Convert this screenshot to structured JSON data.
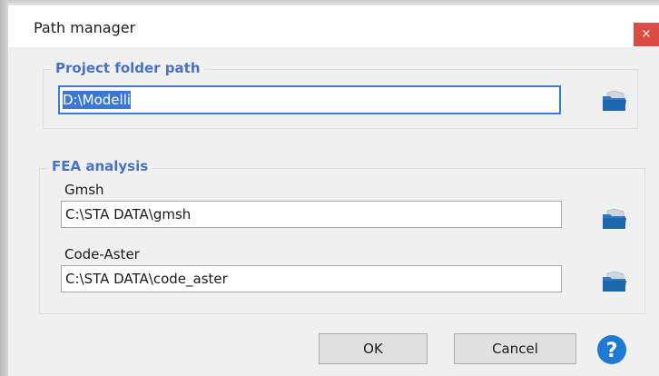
{
  "window": {
    "title": "Path manager",
    "close_label": "×"
  },
  "project": {
    "group_title": "Project folder path",
    "path_value": "D:\\Modelli"
  },
  "fea": {
    "group_title": "FEA analysis",
    "gmsh": {
      "label": "Gmsh",
      "value": "C:\\STA DATA\\gmsh"
    },
    "code_aster": {
      "label": "Code-Aster",
      "value": "C:\\STA DATA\\code_aster"
    }
  },
  "buttons": {
    "ok_label": "OK",
    "cancel_label": "Cancel",
    "help_label": "?"
  },
  "icons": {
    "folder": "folder-open-icon",
    "help": "help-icon",
    "close": "close-icon"
  },
  "colors": {
    "accent_blue": "#4a72c4",
    "focus_border": "#3b7bd9",
    "selection": "#3a78d8",
    "close_red": "#d94b45",
    "help_blue": "#1f7ad6"
  }
}
